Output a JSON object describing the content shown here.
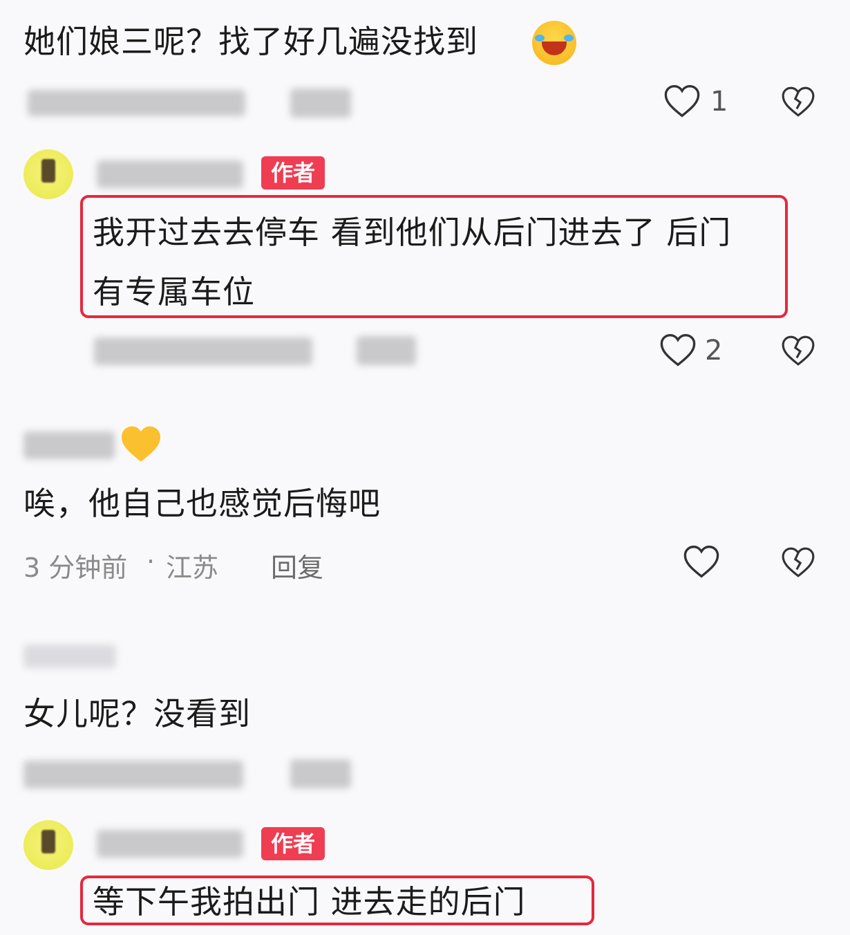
{
  "comments": [
    {
      "text": "她们娘三呢？找了好几遍没找到",
      "likes": "1"
    },
    {
      "badge": "作者",
      "text_line1": "我开过去去停车 看到他们从后门进去了 后门",
      "text_line2": "有专属车位",
      "likes": "2"
    },
    {
      "text": "唉，他自己也感觉后悔吧",
      "time": "3 分钟前",
      "location": "江苏",
      "reply_label": "回复"
    },
    {
      "text": "女儿呢？没看到"
    },
    {
      "badge": "作者",
      "text": "等下午我拍出门 进去走的后门"
    }
  ],
  "icons": {
    "like": "heart-icon",
    "dislike": "broken-heart-icon",
    "emoji": "laughing-crying-emoji-icon",
    "emoji2": "yellow-heart-emoji-icon"
  },
  "colors": {
    "badge": "#ef3d52",
    "highlight": "#e6283c",
    "meta": "#8a8a8a"
  }
}
